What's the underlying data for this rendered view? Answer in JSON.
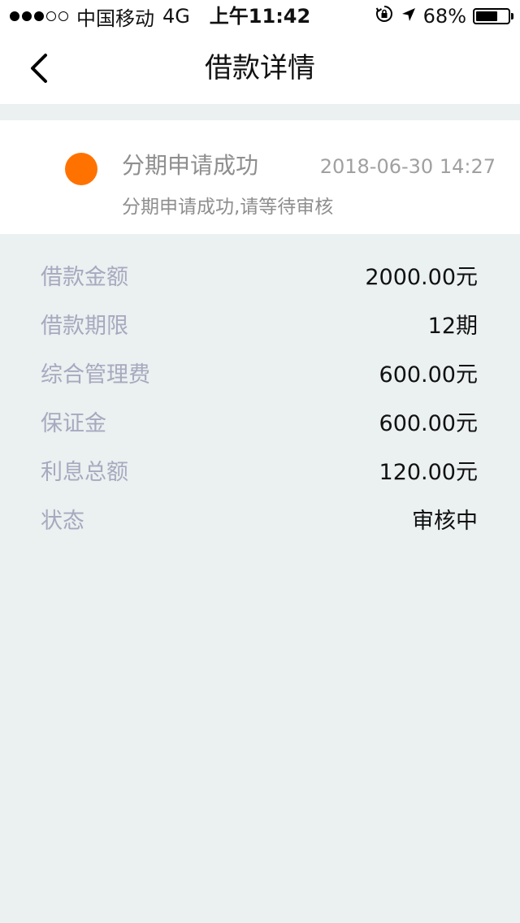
{
  "status_bar": {
    "carrier": "中国移动",
    "network": "4G",
    "time": "上午11:42",
    "battery": "68%",
    "battery_level": 0.68,
    "signal_bars": 3,
    "signal_total": 5,
    "icons": [
      "signal-dots-icon",
      "orientation-lock-icon",
      "location-arrow-icon",
      "battery-icon"
    ]
  },
  "nav": {
    "title": "借款详情",
    "back_icon": "chevron-left-icon"
  },
  "status_card": {
    "title": "分期申请成功",
    "time": "2018-06-30 14:27",
    "subtitle": "分期申请成功,请等待审核",
    "dot_color": "#ff7200"
  },
  "details": [
    {
      "label": "借款金额",
      "value": "2000.00元"
    },
    {
      "label": "借款期限",
      "value": "12期"
    },
    {
      "label": "综合管理费",
      "value": "600.00元"
    },
    {
      "label": "保证金",
      "value": "600.00元"
    },
    {
      "label": "利息总额",
      "value": "120.00元"
    },
    {
      "label": "状态",
      "value": "审核中"
    }
  ],
  "colors": {
    "background": "#ebf0f0",
    "card": "#ffffff",
    "label": "#a7a9bf",
    "accent": "#ff7200"
  }
}
